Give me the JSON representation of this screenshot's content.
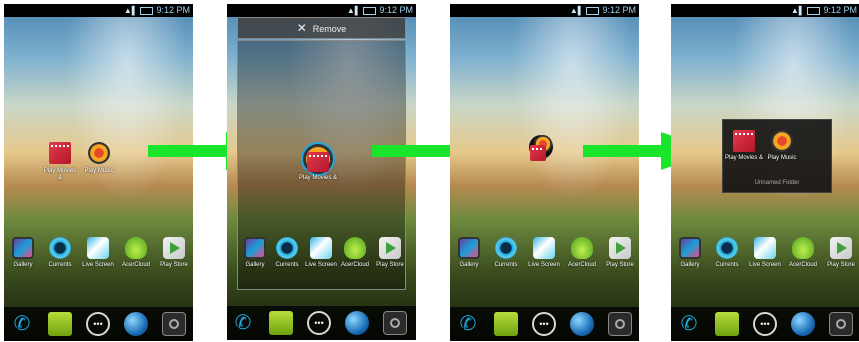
{
  "status_bar": {
    "time": "9:12 PM"
  },
  "panel2": {
    "remove_label": "Remove"
  },
  "home_icons": {
    "movies_label": "Play Movies &",
    "music_label": "Play Music"
  },
  "folder": {
    "movies_label": "Play Movies &",
    "music_label": "Play Music",
    "name": "Unnamed Folder"
  },
  "dock": [
    "Gallery",
    "Currents",
    "Live Screen",
    "AcerCloud",
    "Play Store"
  ],
  "dragged_label": "Play Movies &",
  "arrow_color": "#19e62a"
}
